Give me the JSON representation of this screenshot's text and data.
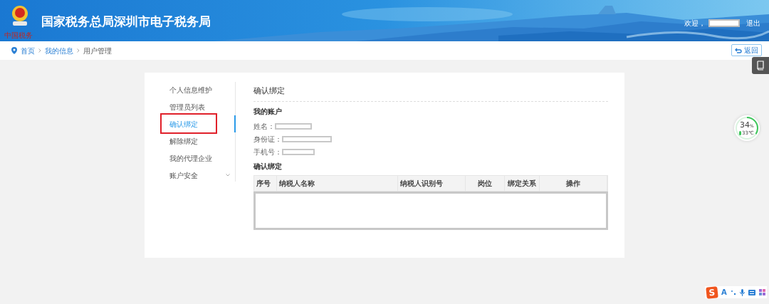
{
  "header": {
    "title": "国家税务总局深圳市电子税务局",
    "emblem_caption": "中国税务",
    "welcome": "欢迎，",
    "logout": "退出"
  },
  "breadcrumb": [
    "首页",
    "我的信息",
    "用户管理"
  ],
  "back_button": "返回",
  "sidebar": [
    {
      "label": "个人信息维护",
      "selected": false,
      "expandable": false,
      "highlighted": false
    },
    {
      "label": "管理员列表",
      "selected": false,
      "expandable": false,
      "highlighted": false
    },
    {
      "label": "确认绑定",
      "selected": true,
      "expandable": false,
      "highlighted": true
    },
    {
      "label": "解除绑定",
      "selected": false,
      "expandable": false,
      "highlighted": false
    },
    {
      "label": "我的代理企业",
      "selected": false,
      "expandable": false,
      "highlighted": false
    },
    {
      "label": "账户安全",
      "selected": false,
      "expandable": true,
      "highlighted": false
    }
  ],
  "content": {
    "title": "确认绑定",
    "account_heading": "我的账户",
    "fields": [
      {
        "label": "姓名："
      },
      {
        "label": "身份证："
      },
      {
        "label": "手机号："
      }
    ],
    "table_heading": "确认绑定",
    "table": {
      "columns": [
        "序号",
        "纳税人名称",
        "纳税人识别号",
        "岗位",
        "绑定关系",
        "操作"
      ]
    }
  },
  "meter": {
    "reading": "34",
    "unit": "%",
    "level": 0.34,
    "temperature": "33℃"
  },
  "ime_toolbar": {
    "logo": "S",
    "mode": "A"
  }
}
